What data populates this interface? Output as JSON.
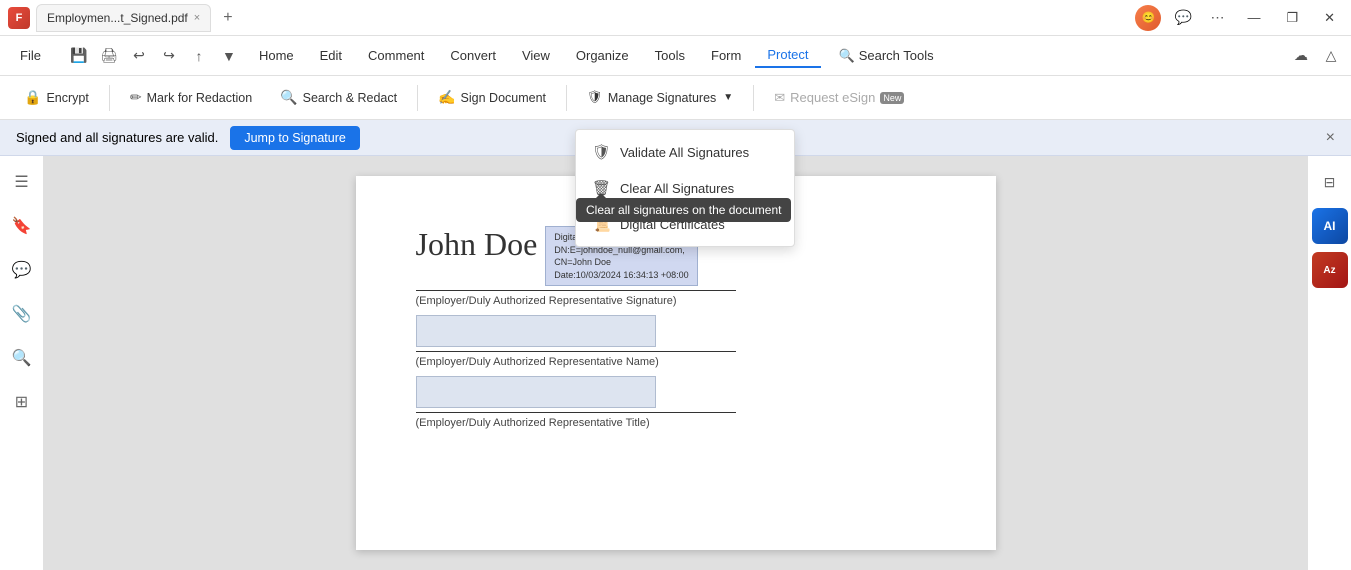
{
  "titlebar": {
    "app_icon_label": "F",
    "tab_title": "Employmen...t_Signed.pdf",
    "close_tab_label": "×",
    "new_tab_label": "+",
    "win_minimize": "—",
    "win_restore": "❐",
    "win_close": "✕"
  },
  "menubar": {
    "file_label": "File",
    "items": [
      {
        "id": "home",
        "label": "Home"
      },
      {
        "id": "edit",
        "label": "Edit"
      },
      {
        "id": "comment",
        "label": "Comment"
      },
      {
        "id": "convert",
        "label": "Convert"
      },
      {
        "id": "view",
        "label": "View"
      },
      {
        "id": "organize",
        "label": "Organize"
      },
      {
        "id": "tools",
        "label": "Tools"
      },
      {
        "id": "form",
        "label": "Form"
      },
      {
        "id": "protect",
        "label": "Protect"
      }
    ],
    "search_tools_label": "Search Tools"
  },
  "toolbar": {
    "encrypt_label": "Encrypt",
    "mark_redaction_label": "Mark for Redaction",
    "search_redact_label": "Search & Redact",
    "sign_document_label": "Sign Document",
    "manage_signatures_label": "Manage Signatures",
    "request_esign_label": "Request eSign",
    "new_badge": "New"
  },
  "notification": {
    "text": "Signed and all signatures are valid.",
    "jump_btn_label": "Jump to Signature",
    "close_label": "×"
  },
  "dropdown_menu": {
    "items": [
      {
        "id": "validate",
        "label": "Validate All Signatures",
        "icon": "shield"
      },
      {
        "id": "clear",
        "label": "Clear All Signatures",
        "icon": "trash"
      },
      {
        "id": "digital",
        "label": "Digital Certificates",
        "icon": "cert"
      }
    ],
    "tooltip": "Clear all signatures on the document"
  },
  "pdf": {
    "signature_name": "John Doe",
    "signer_info": "Digital Signer:John Doe\nDN:E=johndoe_null@gmail.com,\nCN=John Doe\nDate:10/03/2024 16:34:13 +08:00",
    "label_employer_sig": "(Employer/Duly Authorized Representative Signature)",
    "label_employer_name": "(Employer/Duly Authorized Representative Name)",
    "label_employer_title": "(Employer/Duly Authorized Representative Title)"
  },
  "sidebar_left": {
    "icons": [
      {
        "id": "pages",
        "symbol": "☰"
      },
      {
        "id": "bookmarks",
        "symbol": "🔖"
      },
      {
        "id": "comments",
        "symbol": "💬"
      },
      {
        "id": "attachments",
        "symbol": "📎"
      },
      {
        "id": "search",
        "symbol": "🔍"
      },
      {
        "id": "layers",
        "symbol": "⊞"
      }
    ]
  },
  "sidebar_right": {
    "filter_symbol": "⊟",
    "ai_label": "A",
    "az_label": "A"
  },
  "colors": {
    "accent_blue": "#1a73e8",
    "toolbar_active_underline": "#1a73e8",
    "notif_bg": "#e8edf7",
    "pdf_bg": "#e0e0e0",
    "dropdown_tooltip_bg": "#444444"
  }
}
